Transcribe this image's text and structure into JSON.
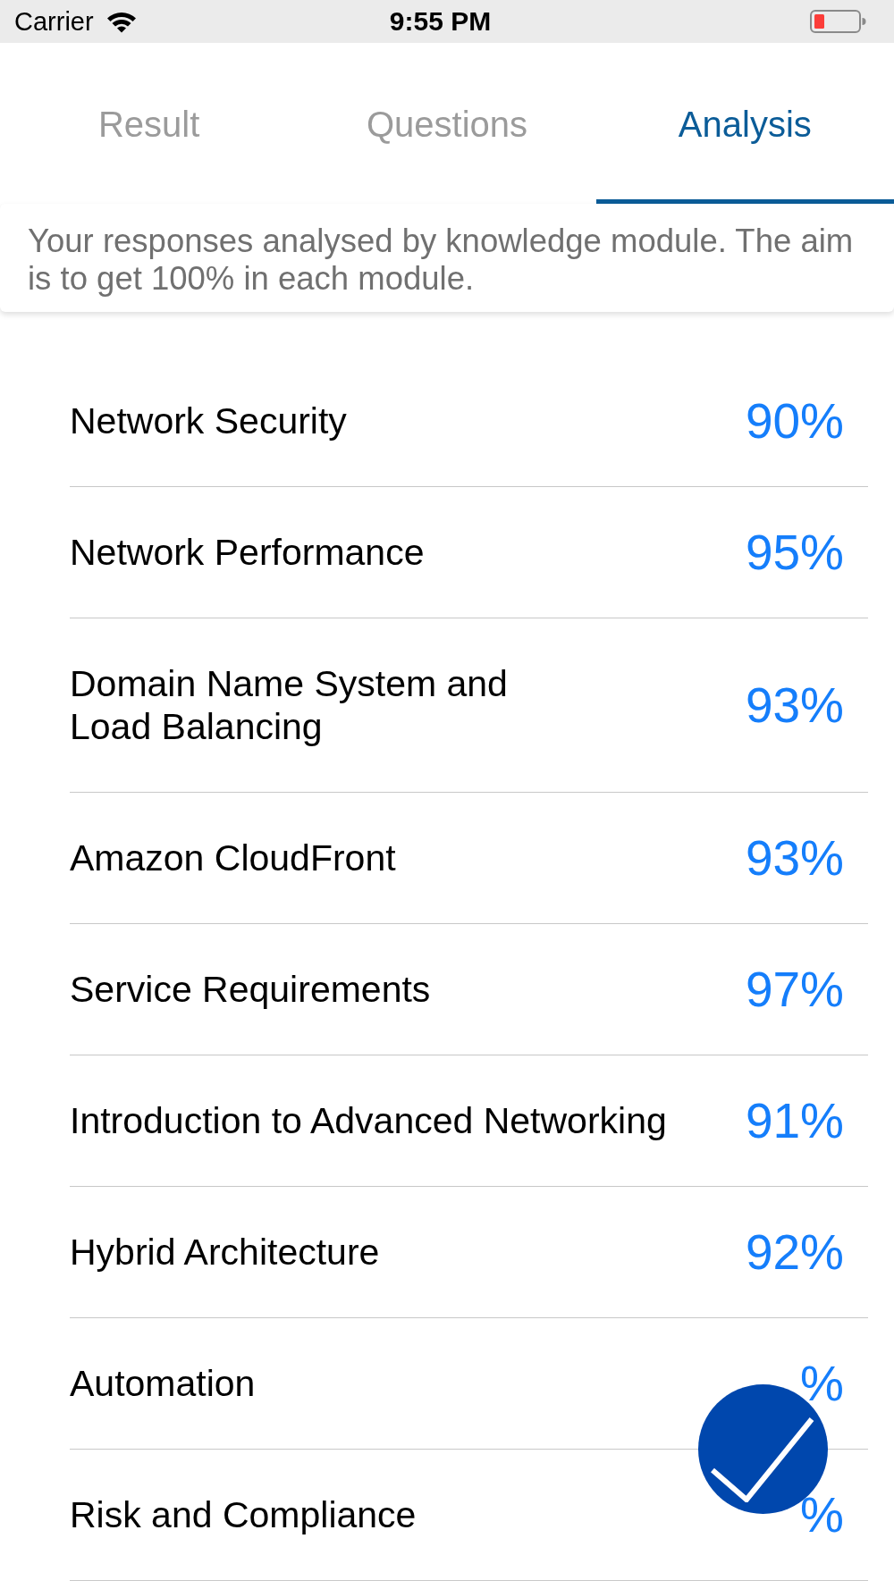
{
  "status_bar": {
    "carrier": "Carrier",
    "time": "9:55 PM"
  },
  "tabs": [
    {
      "label": "Result",
      "selected": false
    },
    {
      "label": "Questions",
      "selected": false
    },
    {
      "label": "Analysis",
      "selected": true
    }
  ],
  "description": "Your responses analysed by knowledge module. The aim is to get 100% in each module.",
  "modules": [
    {
      "name": "Network Security",
      "score": "90%"
    },
    {
      "name": "Network Performance",
      "score": "95%"
    },
    {
      "name": "Domain Name System and\nLoad Balancing",
      "score": "93%"
    },
    {
      "name": "Amazon CloudFront",
      "score": "93%"
    },
    {
      "name": "Service Requirements",
      "score": "97%"
    },
    {
      "name": "Introduction to Advanced Networking",
      "score": "91%"
    },
    {
      "name": "Hybrid Architecture",
      "score": "92%"
    },
    {
      "name": "Automation",
      "score": "%"
    },
    {
      "name": "Risk and Compliance",
      "score": "%"
    }
  ]
}
